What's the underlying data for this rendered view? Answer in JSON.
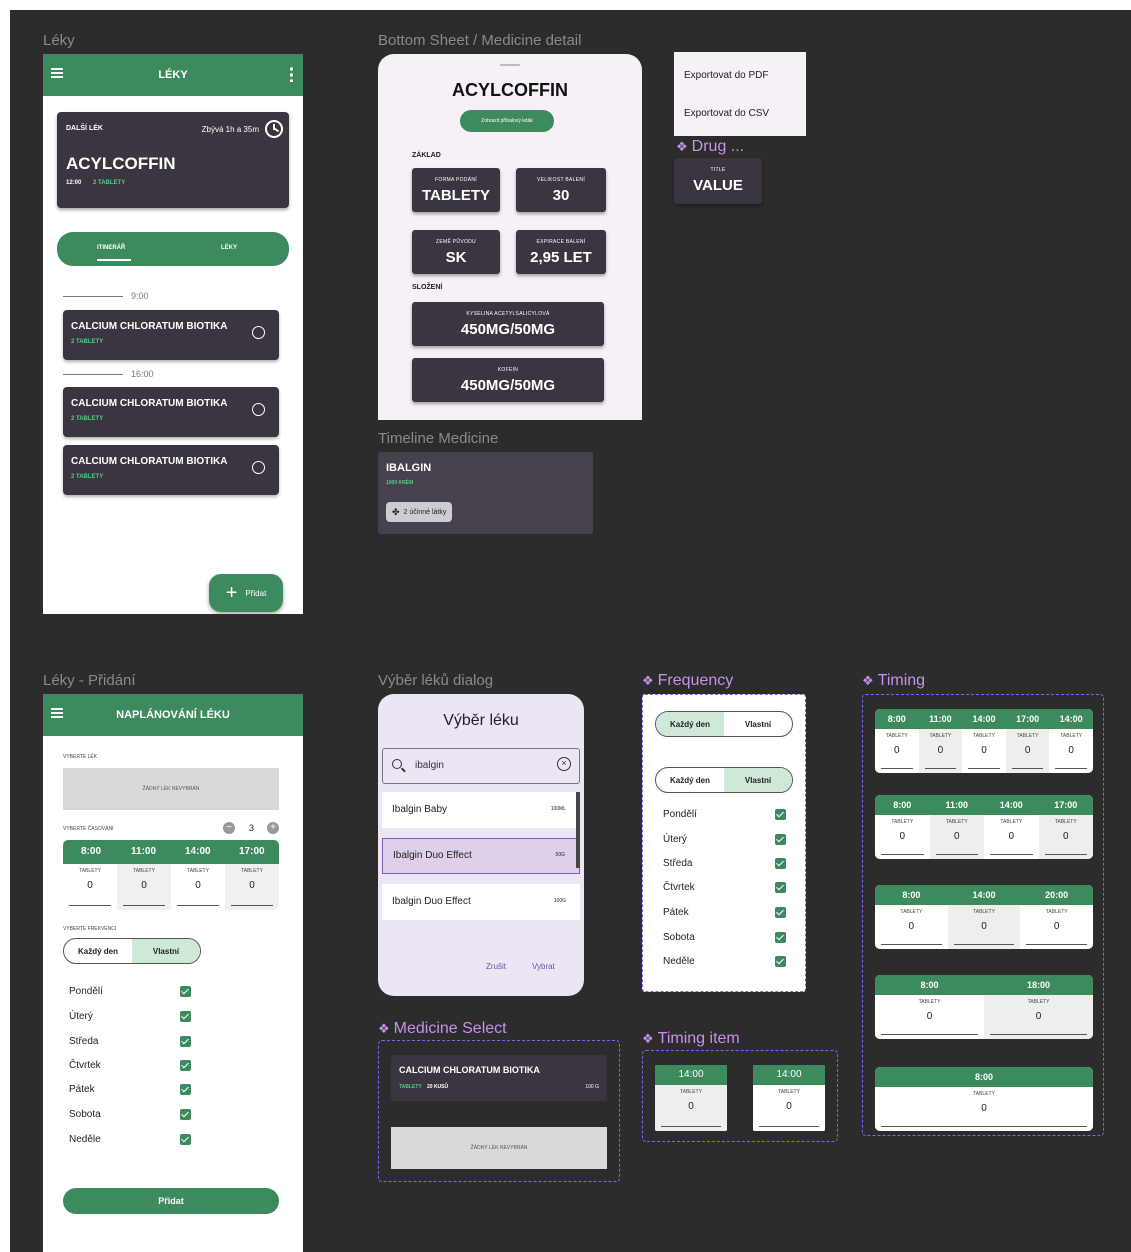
{
  "frames": {
    "leky": "Léky",
    "bottom_sheet": "Bottom Sheet / Medicine detail",
    "timeline_medicine": "Timeline Medicine",
    "leky_pridani": "Léky - Přidání",
    "vyber_dialog": "Výběr léků dialog"
  },
  "components": {
    "drug": "Drug ...",
    "frequency": "Frequency",
    "timing": "Timing",
    "medicine_select": "Medicine Select",
    "timing_item": "Timing item"
  },
  "leky_screen": {
    "title": "LÉKY",
    "next_label": "DALŠÍ LÉK",
    "remaining": "Zbývá 1h a 35m",
    "next_name": "ACYLCOFFIN",
    "next_time": "12:00",
    "next_dose": "2 TABLETY",
    "tab_itinerary": "ITINERÁŘ",
    "tab_leky": "LÉKY",
    "timeline": [
      {
        "time": "9:00"
      },
      {
        "time": "16:00"
      }
    ],
    "meds": [
      {
        "name": "CALCIUM CHLORATUM BIOTIKA",
        "dose": "2 TABLETY"
      },
      {
        "name": "CALCIUM CHLORATUM BIOTIKA",
        "dose": "2 TABLETY"
      },
      {
        "name": "CALCIUM CHLORATUM BIOTIKA",
        "dose": "2 TABLETY"
      }
    ],
    "fab_label": "Přidat"
  },
  "detail": {
    "name": "ACYLCOFFIN",
    "leaflet_button": "Zobrazit příbalový leták",
    "section_zaklad": "ZÁKLAD",
    "tiles": [
      {
        "title": "FORMA PODÁNÍ",
        "value": "TABLETY"
      },
      {
        "title": "VELIKOST BALENÍ",
        "value": "30"
      },
      {
        "title": "ZEMĚ PŮVODU",
        "value": "SK"
      },
      {
        "title": "EXPIRACE BALENÍ",
        "value": "2,95 LET"
      }
    ],
    "section_slozeni": "SLOŽENÍ",
    "composition": [
      {
        "title": "KYSELINA ACETYLSALICYLOVÁ",
        "value": "450MG/50MG"
      },
      {
        "title": "KOFEIN",
        "value": "450MG/50MG"
      }
    ]
  },
  "export_menu": {
    "pdf": "Exportovat do PDF",
    "csv": "Exportovat do CSV"
  },
  "drug_tile": {
    "title": "TITLE",
    "value": "VALUE"
  },
  "timeline_med": {
    "name": "IBALGIN",
    "sub": "1000 KRÉM",
    "chip": "2 účinné látky"
  },
  "pridani": {
    "title": "NAPLÁNOVÁNÍ LÉKU",
    "select_label": "VYBERTE LÉK",
    "no_drug": "ŽÁDNÝ LÉK NEVYBRÁN",
    "timing_label": "VYBERTE ČASOVÁNÍ",
    "count": "3",
    "times": [
      "8:00",
      "11:00",
      "14:00",
      "17:00"
    ],
    "unit": "TABLETY",
    "amount": "0",
    "freq_label": "VYBERTE FREKVENCI",
    "seg_every": "Každý den",
    "seg_custom": "Vlastní",
    "days": [
      "Pondělí",
      "Úterý",
      "Středa",
      "Čtvrtek",
      "Pátek",
      "Sobota",
      "Neděle"
    ],
    "add_button": "Přidat"
  },
  "dialog": {
    "title": "Výběr léku",
    "search_value": "ibalgin",
    "items": [
      {
        "name": "Ibalgin Baby",
        "size": "100ML"
      },
      {
        "name": "Ibalgin Duo Effect",
        "size": "50G"
      },
      {
        "name": "Ibalgin Duo Effect",
        "size": "100G"
      }
    ],
    "cancel": "Zrušit",
    "confirm": "Vybrat"
  },
  "medicine_select": {
    "name": "CALCIUM CHLORATUM BIOTIKA",
    "unit": "TABLETY",
    "count": "20 KUSŮ",
    "amount": "100 G",
    "empty": "ŽÁDNÝ LÉK NEVYBRÁN"
  },
  "timing_variants": [
    [
      "8:00",
      "11:00",
      "14:00",
      "17:00",
      "14:00"
    ],
    [
      "8:00",
      "11:00",
      "14:00",
      "17:00"
    ],
    [
      "8:00",
      "14:00",
      "20:00"
    ],
    [
      "8:00",
      "18:00"
    ],
    [
      "8:00"
    ]
  ],
  "timing_item_time": "14:00",
  "colors": {
    "green": "#3e8a5f",
    "dark_card": "#3b3540",
    "accent_text": "#4fd18a",
    "component_label": "#c792ea"
  }
}
